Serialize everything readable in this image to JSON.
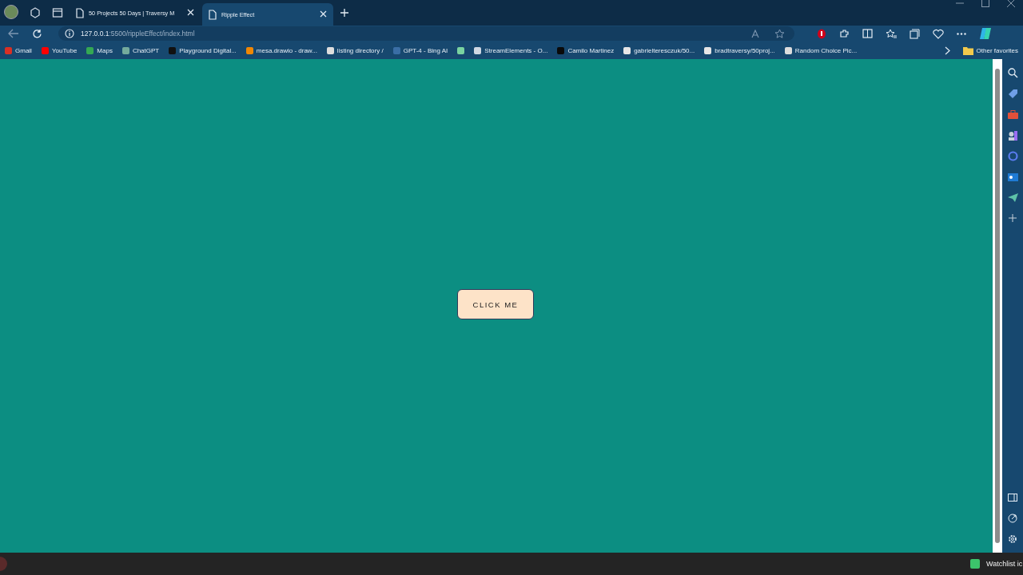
{
  "tabs": [
    {
      "title": "50 Projects 50 Days | Traversy M",
      "selected": false
    },
    {
      "title": "Ripple Effect",
      "selected": true
    }
  ],
  "address": {
    "host": "127.0.0.1",
    "path": ":5500/rippleEffect/index.html"
  },
  "bookmarks": [
    {
      "label": "Gmail",
      "color": "#d93025"
    },
    {
      "label": "YouTube",
      "color": "#ff0000"
    },
    {
      "label": "Maps",
      "color": "#34a853"
    },
    {
      "label": "ChatGPT",
      "color": "#74aa9c"
    },
    {
      "label": "Playground Digital...",
      "color": "#111111"
    },
    {
      "label": "mesa.drawio - draw...",
      "color": "#f08705"
    },
    {
      "label": "listing directory /",
      "color": "#dddddd"
    },
    {
      "label": "GPT-4 - Bing AI",
      "color": "#3a6ea5"
    },
    {
      "color": "#7ad3a0"
    },
    {
      "label": "StreamElements - O...",
      "color": "#cfd8e3"
    },
    {
      "label": "Camilo Martinez",
      "color": "#0a0a0a"
    },
    {
      "label": "gabrielteresczuk/50...",
      "color": "#e6e6e6"
    },
    {
      "label": "bradtraversy/50proj...",
      "color": "#e6e6e6"
    },
    {
      "label": "Random Choice Pic...",
      "color": "#dddddd"
    }
  ],
  "other_favorites": "Other favorites",
  "button": {
    "label": "CLICK ME"
  },
  "taskbar": {
    "notification": "Watchlist ic"
  }
}
